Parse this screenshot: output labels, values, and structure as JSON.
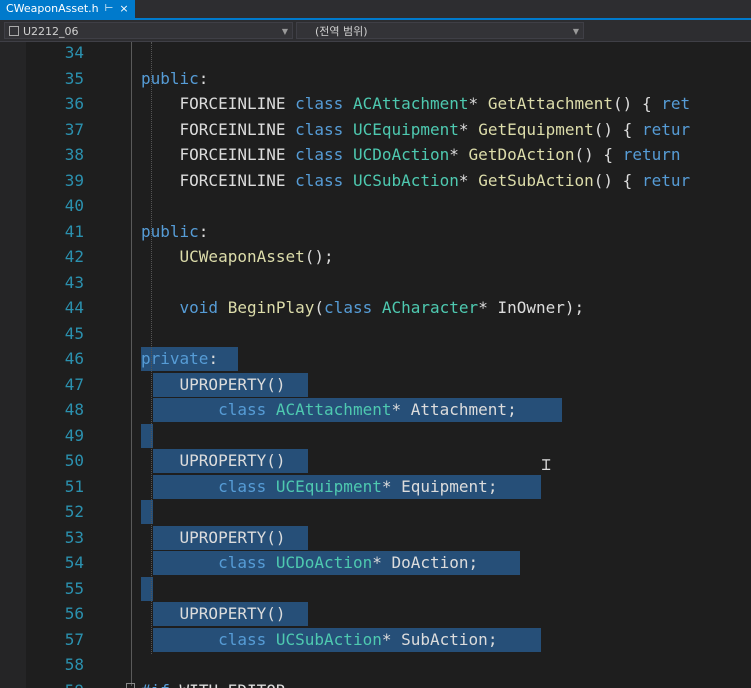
{
  "tab": {
    "title": "CWeaponAsset.h",
    "pin": "⊢",
    "close": "×"
  },
  "nav": {
    "project": "U2212_06",
    "scope": "(전역 범위)"
  },
  "lines": [
    {
      "num": "34",
      "text": "",
      "sel": false
    },
    {
      "num": "35",
      "text": "public:",
      "sel": false
    },
    {
      "num": "36",
      "text": "    FORCEINLINE class ACAttachment* GetAttachment() { ret",
      "sel": false
    },
    {
      "num": "37",
      "text": "    FORCEINLINE class UCEquipment* GetEquipment() { retur",
      "sel": false
    },
    {
      "num": "38",
      "text": "    FORCEINLINE class UCDoAction* GetDoAction() { return ",
      "sel": false
    },
    {
      "num": "39",
      "text": "    FORCEINLINE class UCSubAction* GetSubAction() { retur",
      "sel": false
    },
    {
      "num": "40",
      "text": "",
      "sel": false
    },
    {
      "num": "41",
      "text": "public:",
      "sel": false
    },
    {
      "num": "42",
      "text": "    UCWeaponAsset();",
      "sel": false
    },
    {
      "num": "43",
      "text": "",
      "sel": false
    },
    {
      "num": "44",
      "text": "    void BeginPlay(class ACharacter* InOwner);",
      "sel": false
    },
    {
      "num": "45",
      "text": "",
      "sel": false
    },
    {
      "num": "46",
      "text": "private:",
      "sel": true
    },
    {
      "num": "47",
      "text": "    UPROPERTY()",
      "sel": true
    },
    {
      "num": "48",
      "text": "        class ACAttachment* Attachment;",
      "sel": true
    },
    {
      "num": "49",
      "text": "",
      "sel": true
    },
    {
      "num": "50",
      "text": "    UPROPERTY()",
      "sel": true
    },
    {
      "num": "51",
      "text": "        class UCEquipment* Equipment;",
      "sel": true
    },
    {
      "num": "52",
      "text": "",
      "sel": true
    },
    {
      "num": "53",
      "text": "    UPROPERTY()",
      "sel": true
    },
    {
      "num": "54",
      "text": "        class UCDoAction* DoAction;",
      "sel": true
    },
    {
      "num": "55",
      "text": "",
      "sel": true
    },
    {
      "num": "56",
      "text": "    UPROPERTY()",
      "sel": true
    },
    {
      "num": "57",
      "text": "        class UCSubAction* SubAction;",
      "sel": true
    },
    {
      "num": "58",
      "text": "",
      "sel": false
    },
    {
      "num": "59",
      "text": "#if WITH_EDITOR",
      "sel": false
    }
  ],
  "colors": {
    "keyword": "#569cd6",
    "type": "#4ec9b0",
    "function": "#dcdcaa",
    "plain": "#dcdcdc",
    "lineNumber": "#2b91af",
    "selection": "#264f78",
    "accent": "#007acc"
  },
  "icons": {
    "close": "close-icon",
    "pin": "pin-icon",
    "cursor": "text-cursor-icon",
    "fold": "fold-marker-icon"
  }
}
